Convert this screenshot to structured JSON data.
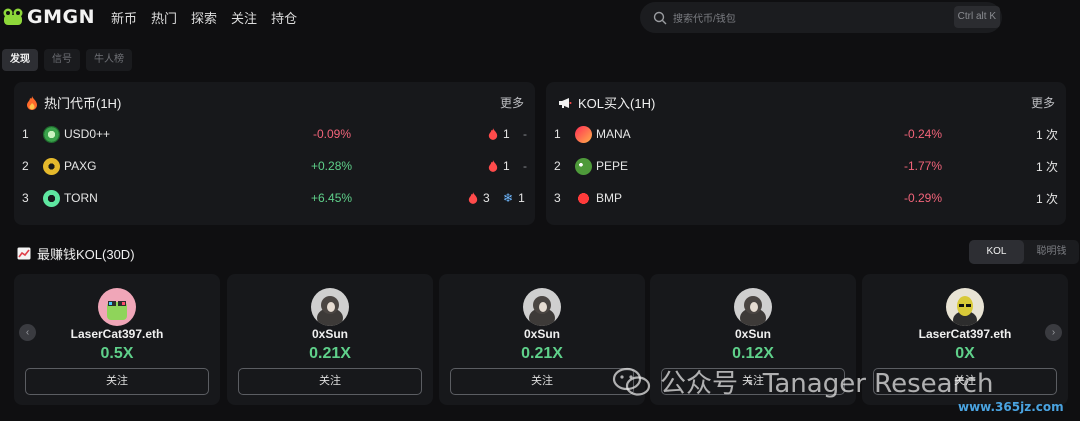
{
  "header": {
    "logo_text": "GMGN",
    "nav": [
      "新币",
      "热门",
      "探索",
      "关注",
      "持仓"
    ],
    "search_placeholder": "搜索代币/钱包",
    "search_shortcut": "Ctrl alt K"
  },
  "tabs": [
    {
      "label": "发现",
      "active": true
    },
    {
      "label": "信号",
      "active": false
    },
    {
      "label": "牛人榜",
      "active": false
    }
  ],
  "hot_tokens": {
    "title": "热门代币(1H)",
    "more": "更多",
    "rows": [
      {
        "rank": "1",
        "name": "USD0++",
        "change": "-0.09%",
        "fire_count": "1",
        "second": "-"
      },
      {
        "rank": "2",
        "name": "PAXG",
        "change": "+0.28%",
        "fire_count": "1",
        "second": "-"
      },
      {
        "rank": "3",
        "name": "TORN",
        "change": "+6.45%",
        "fire_count": "3",
        "second": "1"
      }
    ]
  },
  "kol_buys": {
    "title": "KOL买入(1H)",
    "more": "更多",
    "rows": [
      {
        "rank": "1",
        "name": "MANA",
        "change": "-0.24%",
        "count": "1 次"
      },
      {
        "rank": "2",
        "name": "PEPE",
        "change": "-1.77%",
        "count": "1 次"
      },
      {
        "rank": "3",
        "name": "BMP",
        "change": "-0.29%",
        "count": "1 次"
      }
    ]
  },
  "kol_section": {
    "title": "最赚钱KOL(30D)",
    "toggle": [
      "KOL",
      "聪明钱"
    ],
    "follow_label": "关注",
    "cards": [
      {
        "name": "LaserCat397.eth",
        "value": "0.5X"
      },
      {
        "name": "0xSun",
        "value": "0.21X"
      },
      {
        "name": "0xSun",
        "value": "0.21X"
      },
      {
        "name": "0xSun",
        "value": "0.12X"
      },
      {
        "name": "LaserCat397.eth",
        "value": "0X"
      }
    ]
  },
  "watermark": {
    "text": "公众号 · Tanager Research",
    "site": "www.365jz.com"
  },
  "colors": {
    "negative": "#f2647a",
    "positive": "#5fd08a",
    "background": "#0f0f11",
    "panel": "#17181b"
  }
}
